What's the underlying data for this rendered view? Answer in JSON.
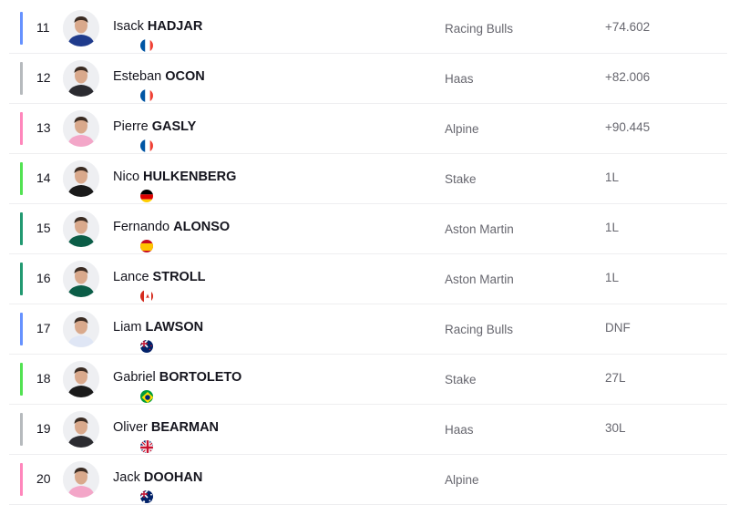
{
  "rows": [
    {
      "position": "11",
      "first_name": "Isack",
      "last_name": "HADJAR",
      "team": "Racing Bulls",
      "gap": "+74.602",
      "team_color": "#6692ff",
      "flag": "fr",
      "suit": "#1f3b8c"
    },
    {
      "position": "12",
      "first_name": "Esteban",
      "last_name": "OCON",
      "team": "Haas",
      "gap": "+82.006",
      "team_color": "#b6babd",
      "flag": "fr",
      "suit": "#2b2b30"
    },
    {
      "position": "13",
      "first_name": "Pierre",
      "last_name": "GASLY",
      "team": "Alpine",
      "gap": "+90.445",
      "team_color": "#ff87bc",
      "flag": "fr",
      "suit": "#f3a6c8"
    },
    {
      "position": "14",
      "first_name": "Nico",
      "last_name": "HULKENBERG",
      "team": "Stake",
      "gap": "1L",
      "team_color": "#52e252",
      "flag": "de",
      "suit": "#1a1a1a"
    },
    {
      "position": "15",
      "first_name": "Fernando",
      "last_name": "ALONSO",
      "team": "Aston Martin",
      "gap": "1L",
      "team_color": "#229971",
      "flag": "es",
      "suit": "#0b5d47"
    },
    {
      "position": "16",
      "first_name": "Lance",
      "last_name": "STROLL",
      "team": "Aston Martin",
      "gap": "1L",
      "team_color": "#229971",
      "flag": "ca",
      "suit": "#0b5d47"
    },
    {
      "position": "17",
      "first_name": "Liam",
      "last_name": "LAWSON",
      "team": "Racing Bulls",
      "gap": "DNF",
      "team_color": "#6692ff",
      "flag": "nz",
      "suit": "#dfe6f5"
    },
    {
      "position": "18",
      "first_name": "Gabriel",
      "last_name": "BORTOLETO",
      "team": "Stake",
      "gap": "27L",
      "team_color": "#52e252",
      "flag": "br",
      "suit": "#1a1a1a"
    },
    {
      "position": "19",
      "first_name": "Oliver",
      "last_name": "BEARMAN",
      "team": "Haas",
      "gap": "30L",
      "team_color": "#b6babd",
      "flag": "gb",
      "suit": "#2b2b30"
    },
    {
      "position": "20",
      "first_name": "Jack",
      "last_name": "DOOHAN",
      "team": "Alpine",
      "gap": "",
      "team_color": "#ff87bc",
      "flag": "au",
      "suit": "#f3a6c8"
    }
  ]
}
